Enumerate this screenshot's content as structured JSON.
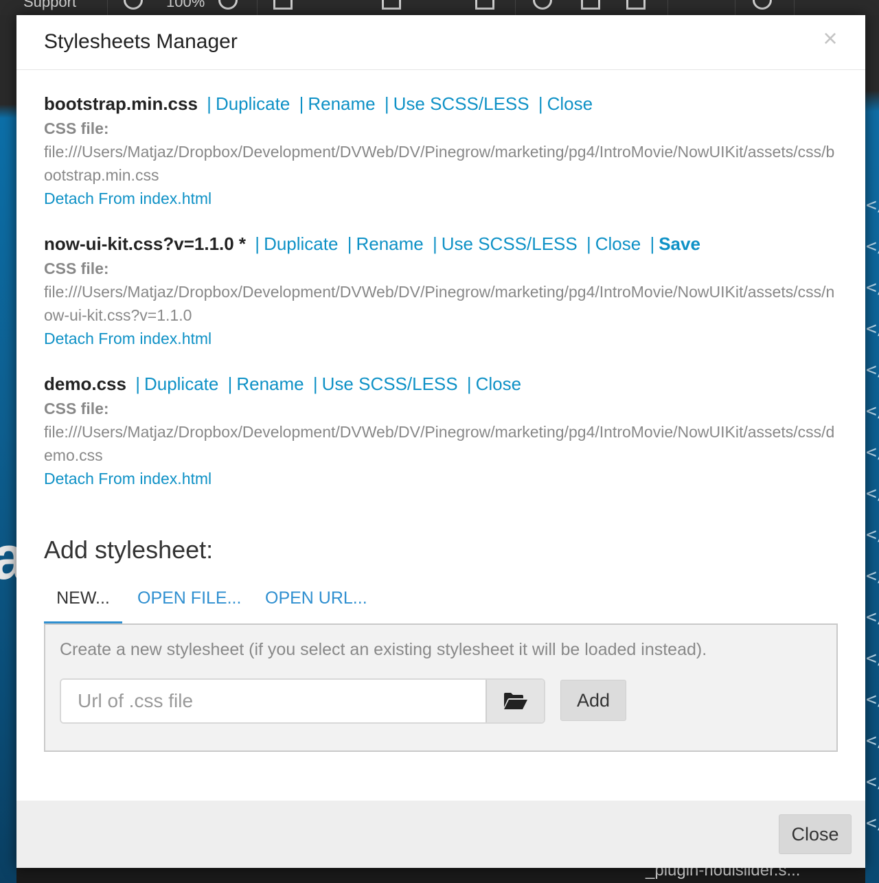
{
  "background": {
    "toolbar": {
      "support_label": "Support",
      "zoom_label": "100%"
    },
    "bottom_file": "_plugin-nouislider.s...",
    "side_letter": "a",
    "tag_glyph": "</"
  },
  "modal": {
    "title": "Stylesheets Manager",
    "close_glyph": "×",
    "sheets": [
      {
        "name": "bootstrap.min.css",
        "actions": [
          "Duplicate",
          "Rename",
          "Use SCSS/LESS",
          "Close"
        ],
        "save_label": "",
        "css_label": "CSS file:",
        "path": "file:///Users/Matjaz/Dropbox/Development/DVWeb/DV/Pinegrow/marketing/pg4/IntroMovie/NowUIKit/assets/css/bootstrap.min.css",
        "detach": "Detach From index.html"
      },
      {
        "name": "now-ui-kit.css?v=1.1.0 *",
        "actions": [
          "Duplicate",
          "Rename",
          "Use SCSS/LESS",
          "Close"
        ],
        "save_label": "Save",
        "css_label": "CSS file:",
        "path": "file:///Users/Matjaz/Dropbox/Development/DVWeb/DV/Pinegrow/marketing/pg4/IntroMovie/NowUIKit/assets/css/now-ui-kit.css?v=1.1.0",
        "detach": "Detach From index.html"
      },
      {
        "name": "demo.css",
        "actions": [
          "Duplicate",
          "Rename",
          "Use SCSS/LESS",
          "Close"
        ],
        "save_label": "",
        "css_label": "CSS file:",
        "path": "file:///Users/Matjaz/Dropbox/Development/DVWeb/DV/Pinegrow/marketing/pg4/IntroMovie/NowUIKit/assets/css/demo.css",
        "detach": "Detach From index.html"
      }
    ],
    "add": {
      "title": "Add stylesheet:",
      "tabs": [
        "NEW...",
        "OPEN FILE...",
        "OPEN URL..."
      ],
      "active_tab": "NEW...",
      "description": "Create a new stylesheet (if you select an existing stylesheet it will be loaded instead).",
      "url_placeholder": "Url of .css file",
      "url_value": "",
      "add_button": "Add"
    },
    "footer": {
      "close_button": "Close"
    }
  },
  "colors": {
    "link": "#0e91c6",
    "tab_link": "#2f8fd0",
    "muted_text": "#888888",
    "footer_bg": "#eeeeee"
  }
}
